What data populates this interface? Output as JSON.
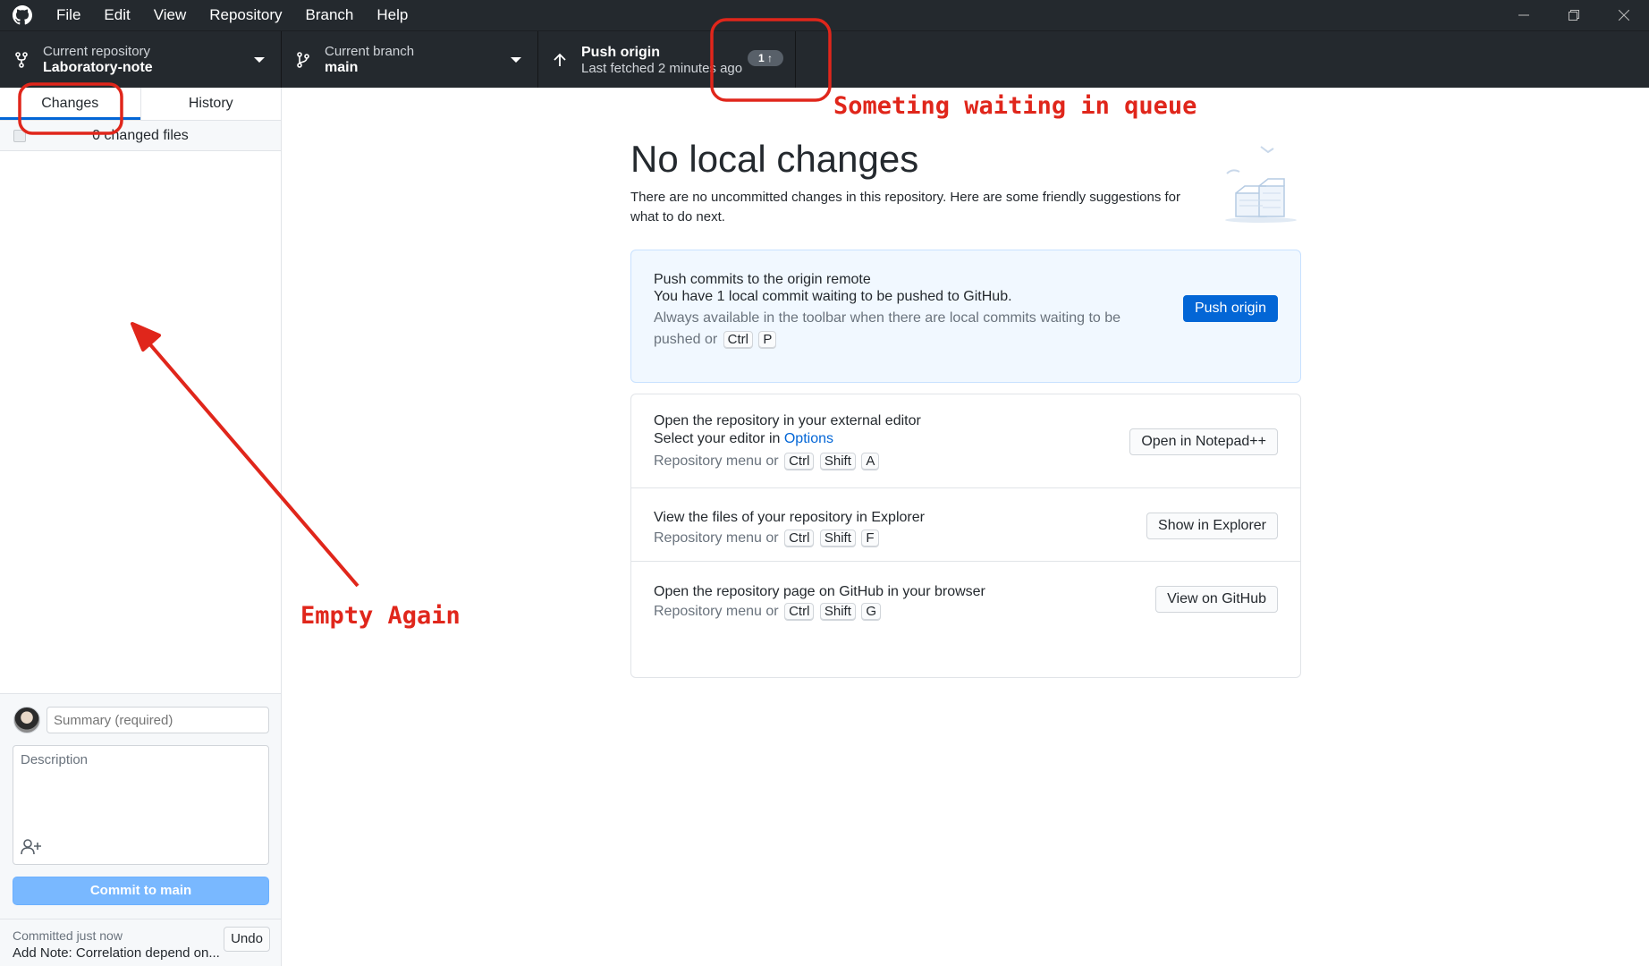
{
  "menu": {
    "items": [
      "File",
      "Edit",
      "View",
      "Repository",
      "Branch",
      "Help"
    ]
  },
  "window_controls": [
    "minimize-icon",
    "restore-icon",
    "close-icon"
  ],
  "toolbar": {
    "repo_label": "Current repository",
    "repo_value": "Laboratory-note",
    "branch_label": "Current branch",
    "branch_value": "main",
    "push_label": "Push origin",
    "push_sub": "Last fetched 2 minutes ago",
    "ahead_badge": "1 ↑"
  },
  "sidebar": {
    "tabs": [
      {
        "label": "Changes",
        "active": true
      },
      {
        "label": "History",
        "active": false
      }
    ],
    "changed_files": "0 changed files",
    "summary_placeholder": "Summary (required)",
    "description_placeholder": "Description",
    "commit_button": "Commit to main",
    "last_commit": {
      "time": "Committed just now",
      "message": "Add Note: Correlation depend on...",
      "undo": "Undo"
    }
  },
  "main": {
    "heading": "No local changes",
    "intro": "There are no uncommitted changes in this repository. Here are some friendly suggestions for what to do next.",
    "push_card": {
      "title": "Push commits to the origin remote",
      "subtitle": "You have 1 local commit waiting to be pushed to GitHub.",
      "hint_line1": "Always available in the toolbar when there are local commits waiting to be",
      "hint_line2": "pushed or",
      "keys": [
        "Ctrl",
        "P"
      ],
      "button": "Push origin"
    },
    "editor_card": {
      "title": "Open the repository in your external editor",
      "subtitle_prefix": "Select your editor in",
      "subtitle_link": "Options",
      "hint": "Repository menu or",
      "keys": [
        "Ctrl",
        "Shift",
        "A"
      ],
      "button": "Open in Notepad++"
    },
    "explorer_card": {
      "title": "View the files of your repository in Explorer",
      "hint": "Repository menu or",
      "keys": [
        "Ctrl",
        "Shift",
        "F"
      ],
      "button": "Show in Explorer"
    },
    "github_card": {
      "title": "Open the repository page on GitHub in your browser",
      "hint": "Repository menu or",
      "keys": [
        "Ctrl",
        "Shift",
        "G"
      ],
      "button": "View on GitHub"
    }
  },
  "annotations": {
    "queue_note": "Someting waiting in queue",
    "empty_note": "Empty Again",
    "color": "#e0261b"
  },
  "colors": {
    "toolbar_bg": "#24292e",
    "accent": "#0366d6",
    "commit_button": "#79b8ff"
  }
}
